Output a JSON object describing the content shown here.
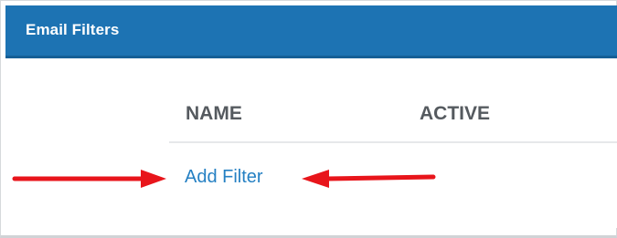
{
  "panel": {
    "title": "Email Filters"
  },
  "table": {
    "columns": [
      "NAME",
      "ACTIVE"
    ]
  },
  "actions": {
    "add_filter_label": "Add Filter"
  },
  "colors": {
    "header_bg": "#1d73b3",
    "link": "#2580c3",
    "annotation_arrow": "#e8151b"
  }
}
